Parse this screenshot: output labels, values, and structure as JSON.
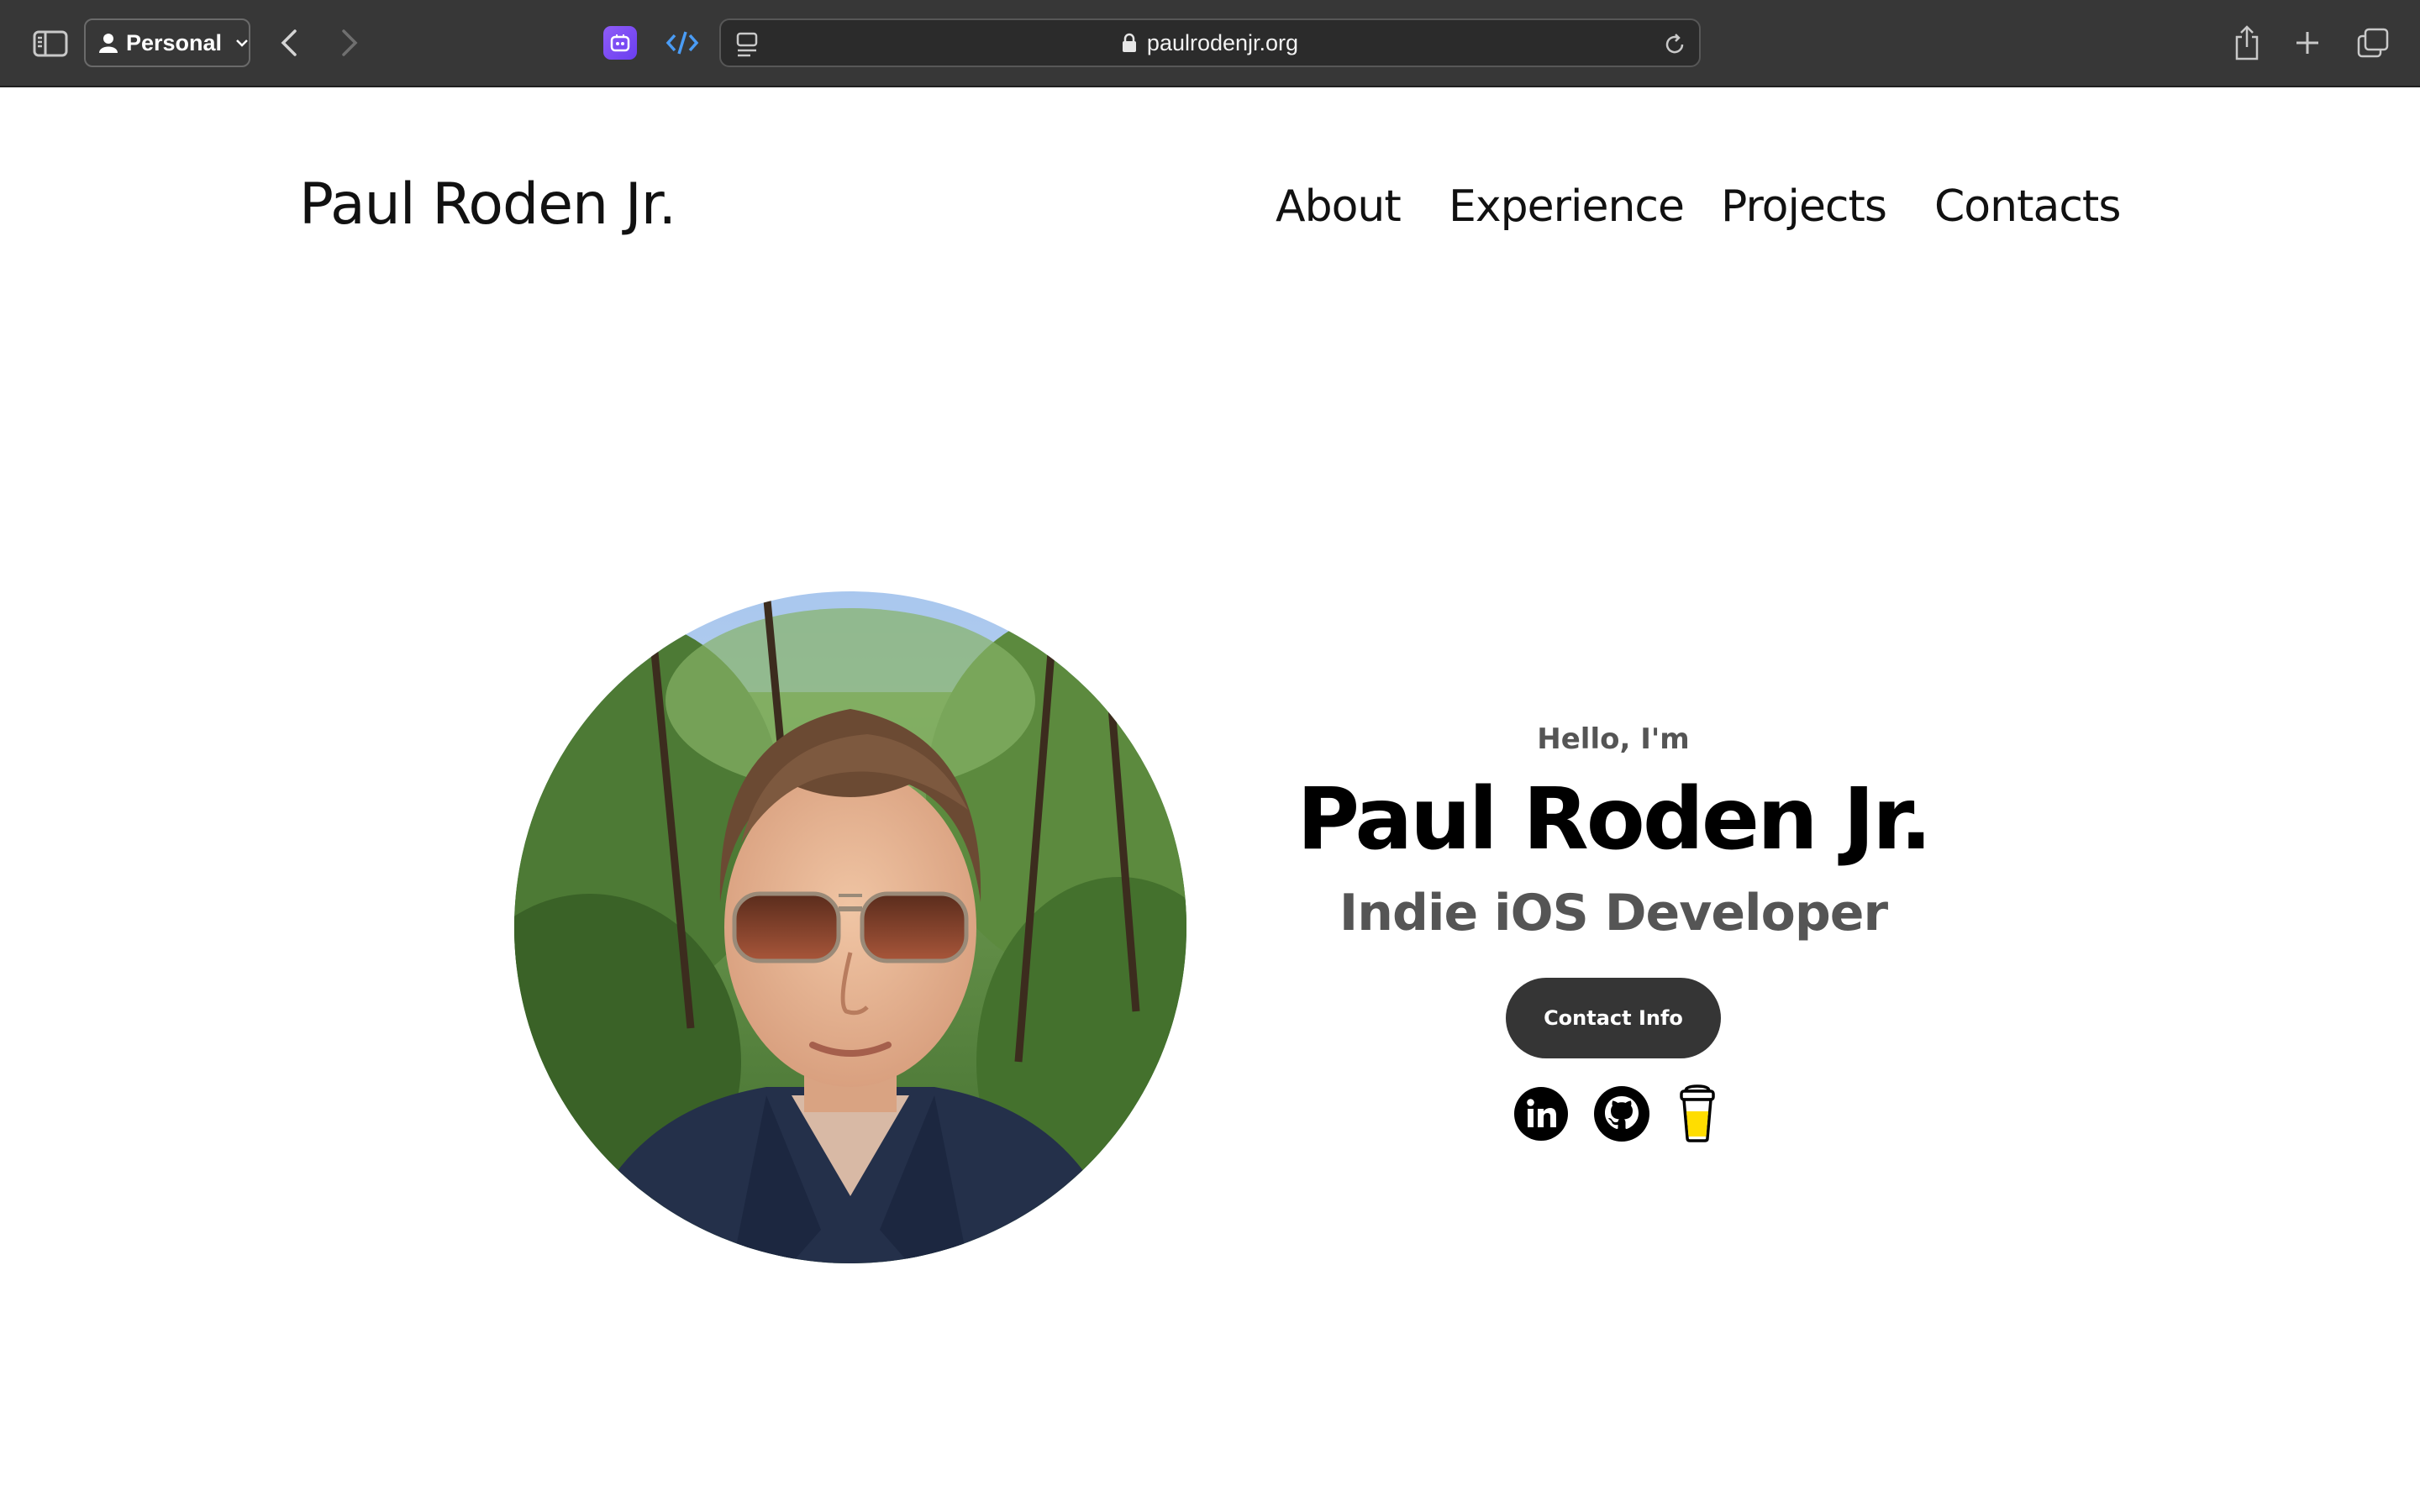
{
  "browser": {
    "profile_label": "Personal",
    "url": "paulrodenjr.org"
  },
  "header": {
    "brand": "Paul Roden Jr.",
    "nav": [
      "About",
      "Experience",
      "Projects",
      "Contacts"
    ]
  },
  "hero": {
    "greeting": "Hello, I'm",
    "name": "Paul Roden Jr.",
    "role": "Indie iOS Developer",
    "contact_button": "Contact Info",
    "socials": [
      "linkedin-icon",
      "github-icon",
      "buy-me-a-coffee-icon"
    ]
  },
  "colors": {
    "chrome_bg": "#373737",
    "button_bg": "#353535",
    "muted_text": "#555555"
  }
}
